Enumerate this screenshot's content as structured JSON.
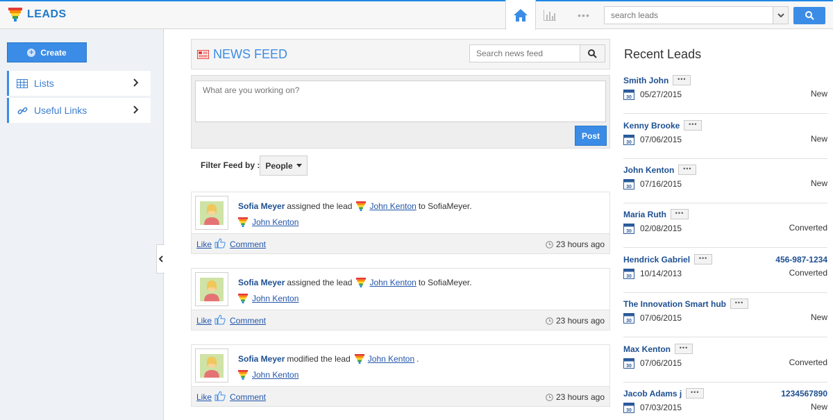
{
  "app": {
    "title": "LEADS"
  },
  "topbar": {
    "search_placeholder": "search leads",
    "more_label": "•••"
  },
  "sidebar": {
    "create_label": "Create",
    "items": [
      {
        "label": "Lists",
        "icon": "list-grid-icon"
      },
      {
        "label": "Useful Links",
        "icon": "link-icon"
      }
    ]
  },
  "feed": {
    "title": "NEWS FEED",
    "search_placeholder": "Search news feed",
    "compose_placeholder": "What are you working on?",
    "post_label": "Post",
    "filter_label": "Filter Feed by :",
    "filter_value": "People",
    "posts": [
      {
        "author": "Sofia Meyer",
        "action": "assigned the lead",
        "lead": "John Kenton",
        "suffix": "to SofiaMeyer.",
        "sub_lead": "John Kenton",
        "like": "Like",
        "comment": "Comment",
        "time": "23 hours ago"
      },
      {
        "author": "Sofia Meyer",
        "action": "assigned the lead",
        "lead": "John Kenton",
        "suffix": "to SofiaMeyer.",
        "sub_lead": "John Kenton",
        "like": "Like",
        "comment": "Comment",
        "time": "23 hours ago"
      },
      {
        "author": "Sofia Meyer",
        "action": "modified the lead",
        "lead": "John Kenton",
        "suffix": ".",
        "sub_lead": "John Kenton",
        "like": "Like",
        "comment": "Comment",
        "time": "23 hours ago"
      }
    ]
  },
  "recent": {
    "title": "Recent Leads",
    "dots_label": "•••",
    "calendar_day": "30",
    "leads": [
      {
        "name": "Smith John",
        "date": "05/27/2015",
        "status": "New",
        "phone": ""
      },
      {
        "name": "Kenny Brooke",
        "date": "07/06/2015",
        "status": "New",
        "phone": ""
      },
      {
        "name": "John Kenton",
        "date": "07/16/2015",
        "status": "New",
        "phone": ""
      },
      {
        "name": "Maria Ruth",
        "date": "02/08/2015",
        "status": "Converted",
        "phone": ""
      },
      {
        "name": "Hendrick Gabriel",
        "date": "10/14/2013",
        "status": "Converted",
        "phone": "456-987-1234"
      },
      {
        "name": "The Innovation Smart hub",
        "date": "07/06/2015",
        "status": "New",
        "phone": ""
      },
      {
        "name": "Max Kenton",
        "date": "07/06/2015",
        "status": "Converted",
        "phone": ""
      },
      {
        "name": "Jacob Adams j",
        "date": "07/03/2015",
        "status": "New",
        "phone": "1234567890"
      }
    ]
  },
  "colors": {
    "accent": "#3b8ce6",
    "brand": "#1e7ac8",
    "link": "#2255aa"
  }
}
